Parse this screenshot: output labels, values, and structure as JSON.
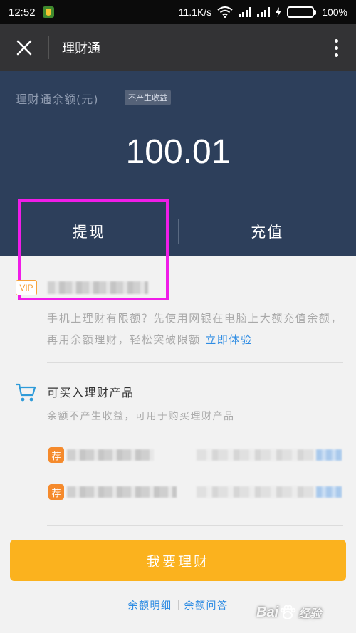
{
  "status_bar": {
    "time": "12:52",
    "network_speed": "11.1K/s",
    "battery_percent": "100%",
    "battery_level": 1.0,
    "icons": [
      "app-notification-icon",
      "wifi-icon",
      "signal-icon",
      "charging-icon",
      "battery-icon"
    ]
  },
  "header": {
    "title": "理财通",
    "close_icon": "close-icon",
    "more_icon": "more-vertical-icon"
  },
  "balance": {
    "label": "理财通余额(元)",
    "badge": "不产生收益",
    "amount": "100.01",
    "withdraw_label": "提现",
    "recharge_label": "充值"
  },
  "vip": {
    "badge": "VIP",
    "description": "手机上理财有限额？先使用网银在电脑上大额充值余额，再用余额理财，轻松突破限额",
    "link": "立即体验"
  },
  "products": {
    "title": "可买入理财产品",
    "description": "余额不产生收益，可用于购买理财产品",
    "items": [
      {
        "badge": "荐"
      },
      {
        "badge": "荐"
      }
    ]
  },
  "actions": {
    "invest_label": "我要理财",
    "balance_detail": "余额明细",
    "balance_faq": "余额问答"
  },
  "watermark": {
    "text": "Bai",
    "subtext": "经验"
  },
  "colors": {
    "panel_bg": "#2d3f5b",
    "accent_orange": "#fbb21e",
    "link_blue": "#2e8ce3",
    "highlight_magenta": "#f01de8",
    "recommend_badge": "#f58a2c"
  }
}
